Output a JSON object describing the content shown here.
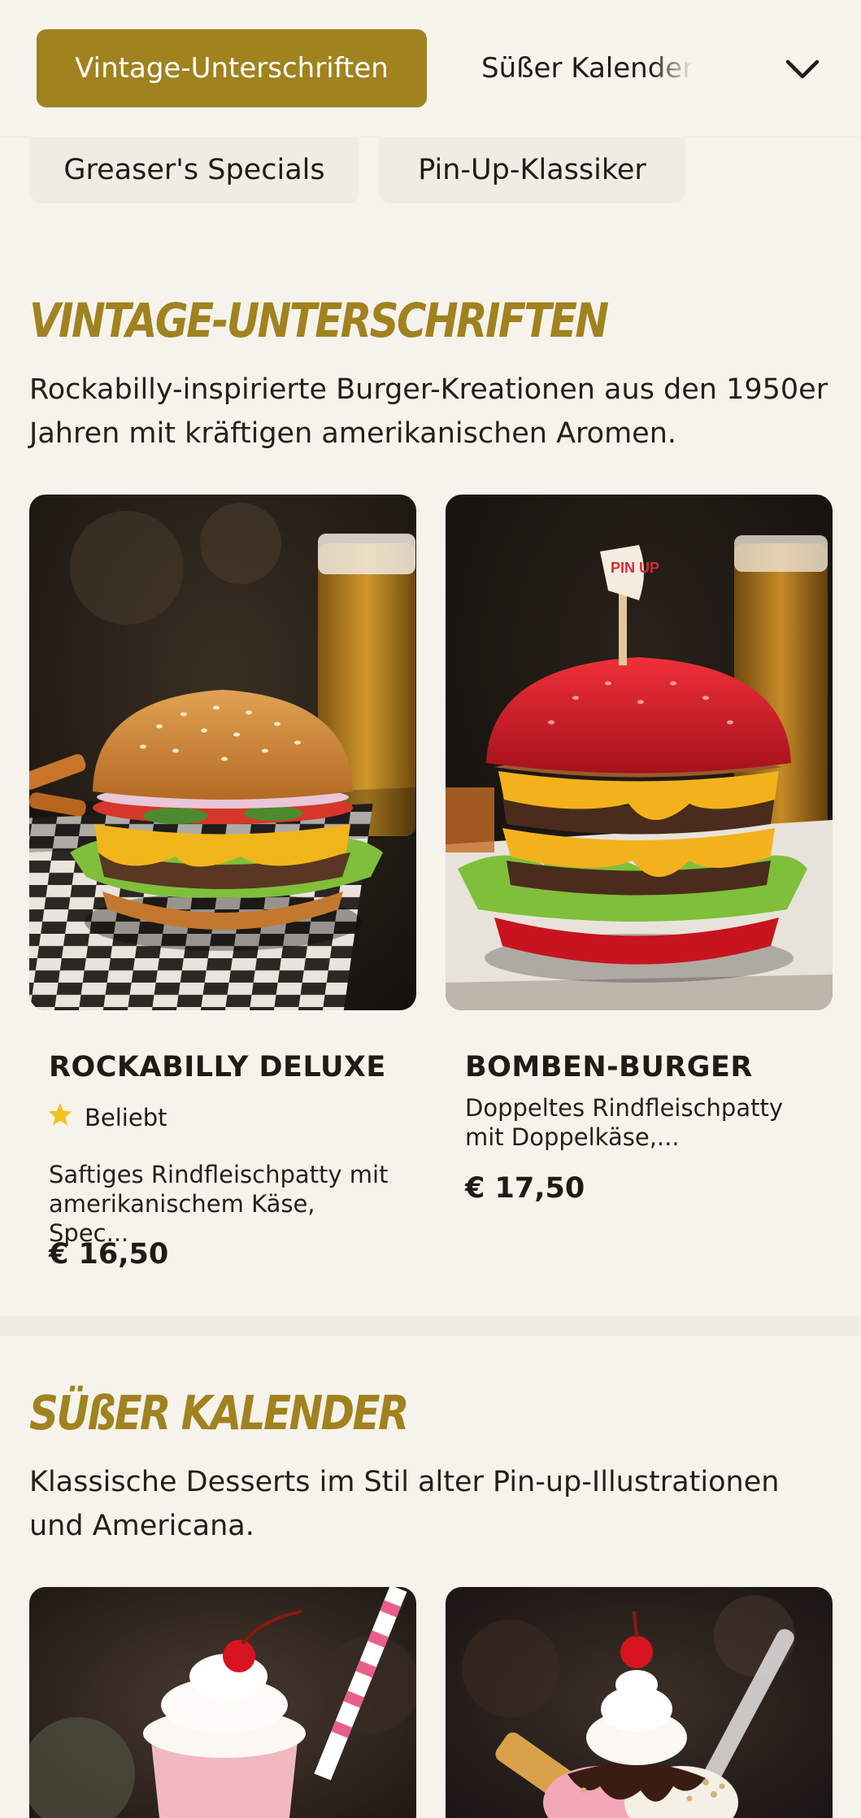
{
  "nav": {
    "active_tab": "Vintage-Unterschriften",
    "next_tab": "Süßer Kalender",
    "sub_tabs": [
      "Greaser's Specials",
      "Pin-Up-Klassiker"
    ]
  },
  "sections": [
    {
      "title": "VINTAGE-UNTERSCHRIFTEN",
      "description": "Rockabilly-inspirierte Burger-Kreationen aus den 1950er Jahren mit kräftigen amerikanischen Aromen.",
      "items": [
        {
          "name": "ROCKABILLY DELUXE",
          "badge": "Beliebt",
          "description": "Saftiges Rindfleischpatty mit amerikanischem Käse, Spec...",
          "price": "€ 16,50"
        },
        {
          "name": "BOMBEN-BURGER",
          "description": "Doppeltes Rindfleischpatty mit Doppelkäse,...",
          "price": "€ 17,50"
        }
      ]
    },
    {
      "title": "SÜßER KALENDER",
      "description": "Klassische Desserts im Stil alter Pin-up-Illustrationen und Americana."
    }
  ],
  "colors": {
    "accent": "#a0821e",
    "background": "#f6f3ed",
    "star": "#f2c21b"
  },
  "icons": {
    "dropdown": "chevron-down-icon",
    "badge": "star-icon",
    "pick": "pin-up-flag-pick"
  },
  "image_text": {
    "pick_flag": "PIN UP"
  }
}
